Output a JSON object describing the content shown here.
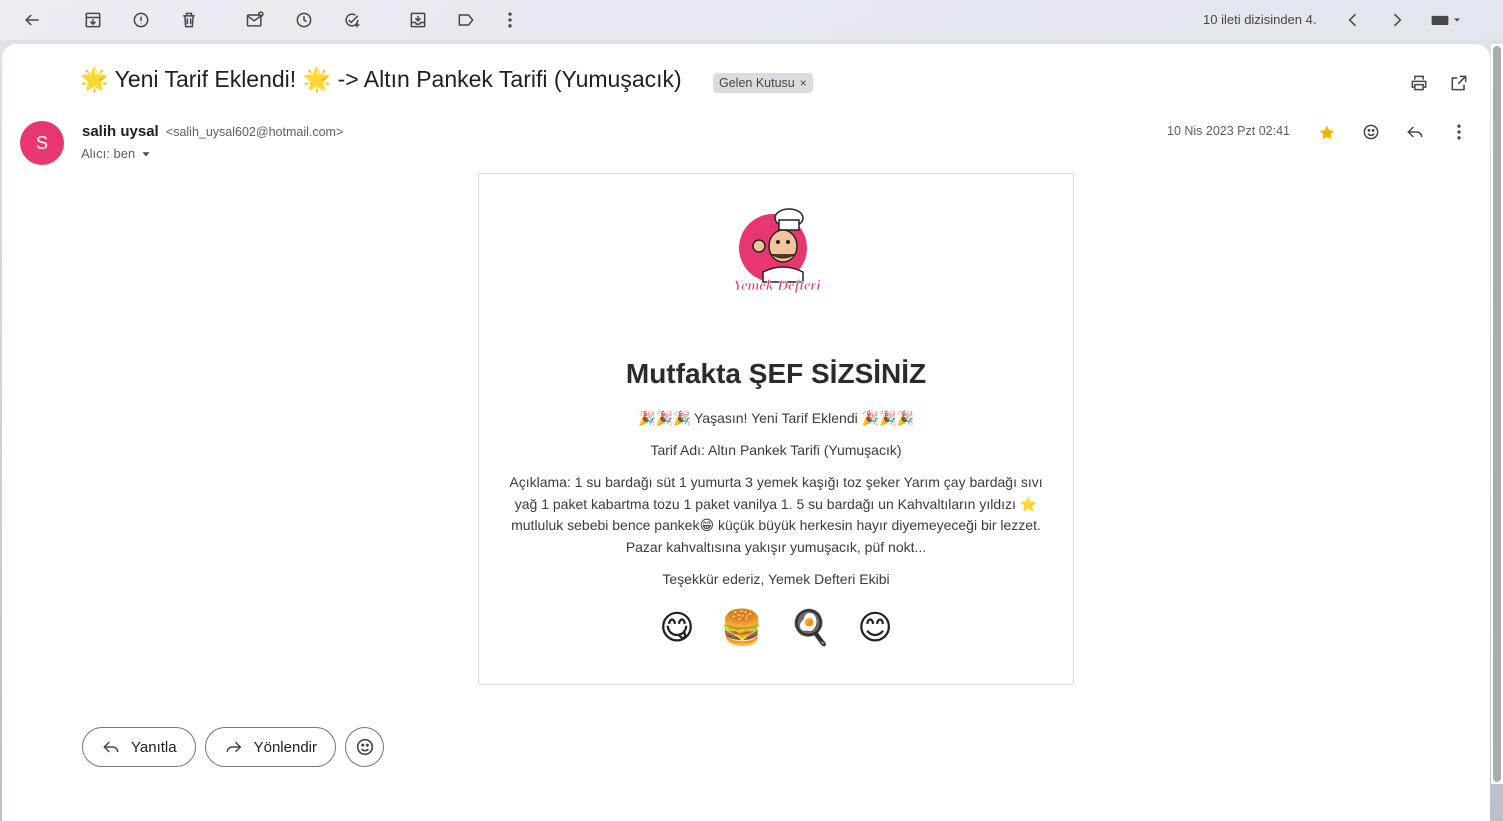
{
  "toolbar": {
    "pager_text": "10 ileti dizisinden 4.",
    "icons": [
      "back-arrow-icon",
      "archive-icon",
      "report-spam-icon",
      "delete-icon",
      "mark-unread-icon",
      "snooze-icon",
      "add-task-icon",
      "move-to-icon",
      "label-icon",
      "more-vert-icon",
      "chevron-left-icon",
      "chevron-right-icon",
      "keyboard-icon"
    ]
  },
  "email": {
    "subject": "🌟 Yeni Tarif Eklendi! 🌟 -> Altın Pankek Tarifi (Yumuşacık)",
    "label": "Gelen Kutusu",
    "label_close": "×",
    "sender": {
      "initial": "S",
      "name": "salih uysal",
      "email": "<salih_uysal602@hotmail.com>",
      "avatar_color": "#e8366e"
    },
    "recipient": "Alıcı: ben",
    "date": "10 Nis 2023 Pzt 02:41",
    "starred": true,
    "star_color": "#f6b400"
  },
  "card": {
    "logo_text": "Yemek Defteri",
    "headline": "Mutfakta ŞEF SİZSİNİZ",
    "celebration": "🎉🎉🎉 Yaşasın! Yeni Tarif Eklendi 🎉🎉🎉",
    "recipe_name": "Tarif Adı: Altın Pankek Tarifi (Yumuşacık)",
    "description": "Açıklama: 1 su bardağı süt 1 yumurta 3 yemek kaşığı toz şeker Yarım çay bardağı sıvı yağ 1 paket kabartma tozu 1 paket vanilya 1. 5 su bardağı un Kahvaltıların yıldızı ⭐ mutluluk sebebi bence pankek😁 küçük büyük herkesin hayır diyemeyeceği bir lezzet. Pazar kahvaltısına yakışır yumuşacık, püf nokt...",
    "thanks": "Teşekkür ederiz, Yemek Defteri Ekibi",
    "emojis": [
      "😋",
      "🍔",
      "🍳",
      "😊"
    ]
  },
  "actions": {
    "reply": "Yanıtla",
    "forward": "Yönlendir"
  }
}
